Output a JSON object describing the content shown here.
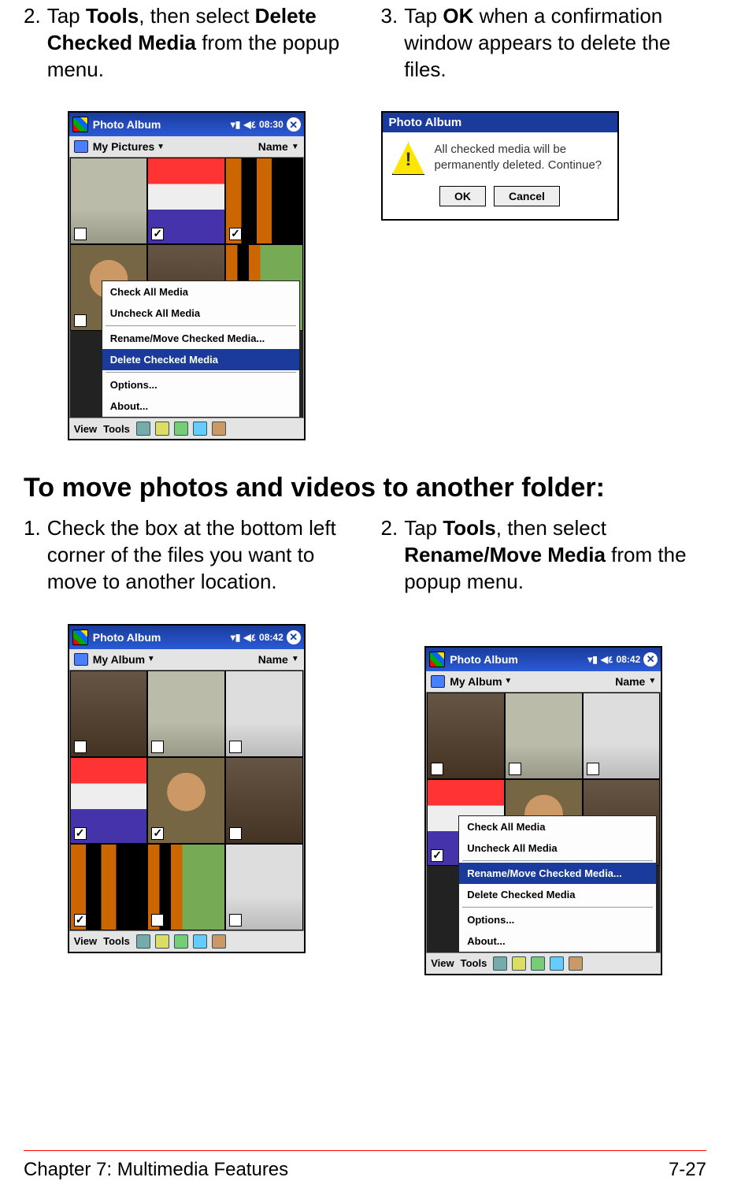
{
  "steps_top": {
    "s2": {
      "num": "2.",
      "pre": "Tap ",
      "bold1": "Tools",
      "mid": ", then select ",
      "bold2": "Delete Checked Media",
      "post": " from the popup menu."
    },
    "s3": {
      "num": "3.",
      "pre": "Tap ",
      "bold1": "OK",
      "post": " when a confirmation window appears to delete the files."
    }
  },
  "section_heading": "To move photos and videos to another folder:",
  "steps_bottom": {
    "s1": {
      "num": "1.",
      "text": "Check the box at the bottom left corner of the files you want to move to another location."
    },
    "s2": {
      "num": "2.",
      "pre": "Tap ",
      "bold1": "Tools",
      "mid": ", then select ",
      "bold2": "Rename/Move Media",
      "post": " from the popup menu."
    }
  },
  "pda_a": {
    "title": "Photo Album",
    "time": "08:30",
    "close": "✕",
    "folder": "My Pictures",
    "name_label": "Name",
    "menu": {
      "m1": "Check All Media",
      "m2": "Uncheck All Media",
      "m3": "Rename/Move Checked Media...",
      "m4": "Delete Checked Media",
      "m5": "Options...",
      "m6": "About..."
    },
    "toolbar": {
      "view": "View",
      "tools": "Tools"
    }
  },
  "dialog": {
    "title": "Photo Album",
    "message": "All checked media will be permanently deleted. Continue?",
    "ok": "OK",
    "cancel": "Cancel"
  },
  "pda_b": {
    "title": "Photo Album",
    "time": "08:42",
    "close": "✕",
    "folder": "My Album",
    "name_label": "Name",
    "toolbar": {
      "view": "View",
      "tools": "Tools"
    }
  },
  "pda_c": {
    "title": "Photo Album",
    "time": "08:42",
    "close": "✕",
    "folder": "My Album",
    "name_label": "Name",
    "menu": {
      "m1": "Check All Media",
      "m2": "Uncheck All Media",
      "m3": "Rename/Move Checked Media...",
      "m4": "Delete Checked Media",
      "m5": "Options...",
      "m6": "About..."
    },
    "toolbar": {
      "view": "View",
      "tools": "Tools"
    }
  },
  "footer": {
    "left": "Chapter 7: Multimedia Features",
    "right": "7-27"
  }
}
